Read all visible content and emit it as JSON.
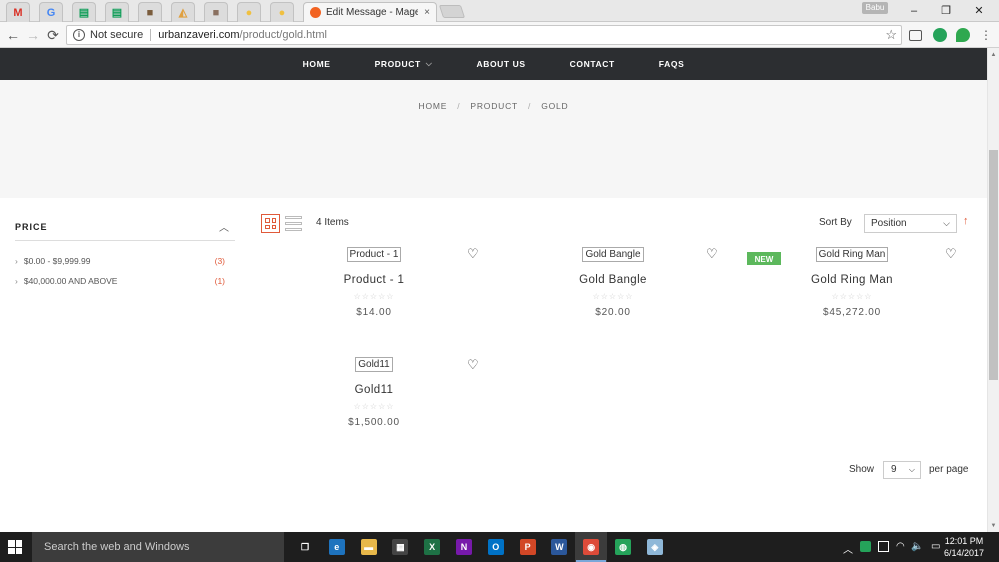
{
  "browser": {
    "mini_tabs": [
      {
        "icon": "gmail-icon",
        "glyph": "M",
        "color": "#d93025"
      },
      {
        "icon": "google-icon",
        "glyph": "G",
        "color": "#4285f4"
      },
      {
        "icon": "sheets-icon",
        "glyph": "▤",
        "color": "#0f9d58"
      },
      {
        "icon": "sheets-icon",
        "glyph": "▤",
        "color": "#0f9d58"
      },
      {
        "icon": "site-icon",
        "glyph": "■",
        "color": "#7a5c3c"
      },
      {
        "icon": "site-icon",
        "glyph": "◭",
        "color": "#e0a040"
      },
      {
        "icon": "site-icon",
        "glyph": "■",
        "color": "#8a7060"
      },
      {
        "icon": "site-icon",
        "glyph": "●",
        "color": "#f0c040"
      },
      {
        "icon": "site-icon",
        "glyph": "●",
        "color": "#f0c040"
      }
    ],
    "active_tab_title": "Edit Message - Magento",
    "close_glyph": "×",
    "user_name": "Babu",
    "minimize_glyph": "–",
    "restore_glyph": "❐",
    "window_close_glyph": "✕",
    "back_glyph": "←",
    "forward_glyph": "→",
    "reload_glyph": "⟳",
    "info_glyph": "i",
    "security_label": "Not secure",
    "url_host": "urbanzaveri.com",
    "url_path": "/product/gold.html",
    "star_glyph": "☆"
  },
  "site": {
    "nav": [
      {
        "label": "HOME",
        "has_dropdown": false
      },
      {
        "label": "PRODUCT",
        "has_dropdown": true
      },
      {
        "label": "ABOUT US",
        "has_dropdown": false
      },
      {
        "label": "CONTACT",
        "has_dropdown": false
      },
      {
        "label": "FAQS",
        "has_dropdown": false
      }
    ],
    "breadcrumb": [
      "HOME",
      "PRODUCT",
      "GOLD"
    ],
    "breadcrumb_sep": "/"
  },
  "filter": {
    "title": "PRICE",
    "toggle_glyph": "︿",
    "items": [
      {
        "label": "$0.00 - $9,999.99",
        "count": "(3)"
      },
      {
        "label": "$40,000.00 AND ABOVE",
        "count": "(1)"
      }
    ],
    "caret_glyph": "›"
  },
  "toolbar": {
    "items_count": "4 Items",
    "sort_label": "Sort By",
    "sort_value": "Position",
    "sort_dropdown_glyph": "⌵",
    "sort_direction_glyph": "↑",
    "show_label": "Show",
    "show_value": "9",
    "per_page_label": "per page"
  },
  "products": [
    {
      "image_alt": "Product - 1",
      "name": "Product - 1",
      "price": "$14.00",
      "stars": "☆☆☆☆☆",
      "is_new": false
    },
    {
      "image_alt": "Gold Bangle",
      "name": "Gold Bangle",
      "price": "$20.00",
      "stars": "☆☆☆☆☆",
      "is_new": false
    },
    {
      "image_alt": "Gold Ring Man",
      "name": "Gold Ring Man",
      "price": "$45,272.00",
      "stars": "☆☆☆☆☆",
      "is_new": true
    },
    {
      "image_alt": "Gold11",
      "name": "Gold11",
      "price": "$1,500.00",
      "stars": "☆☆☆☆☆",
      "is_new": false
    }
  ],
  "wishlist_glyph": "♡",
  "new_badge": "NEW",
  "taskbar": {
    "search_placeholder": "Search the web and Windows",
    "apps": [
      {
        "icon": "task-view-icon",
        "glyph": "❐",
        "color": "transparent"
      },
      {
        "icon": "edge-icon",
        "glyph": "e",
        "color": "#1e73be"
      },
      {
        "icon": "file-explorer-icon",
        "glyph": "▬",
        "color": "#e8b84a"
      },
      {
        "icon": "store-icon",
        "glyph": "▦",
        "color": "#444"
      },
      {
        "icon": "excel-icon",
        "glyph": "X",
        "color": "#1e7145"
      },
      {
        "icon": "onenote-icon",
        "glyph": "N",
        "color": "#7719aa"
      },
      {
        "icon": "outlook-icon",
        "glyph": "O",
        "color": "#0072c6"
      },
      {
        "icon": "powerpoint-icon",
        "glyph": "P",
        "color": "#d24726"
      },
      {
        "icon": "word-icon",
        "glyph": "W",
        "color": "#2b579a"
      },
      {
        "icon": "chrome-icon",
        "glyph": "◉",
        "color": "#dd4b39"
      },
      {
        "icon": "app-icon",
        "glyph": "◍",
        "color": "#25a35a"
      },
      {
        "icon": "app-icon",
        "glyph": "◈",
        "color": "#8fb8d8"
      }
    ],
    "time": "12:01 PM",
    "date": "6/14/2017"
  }
}
